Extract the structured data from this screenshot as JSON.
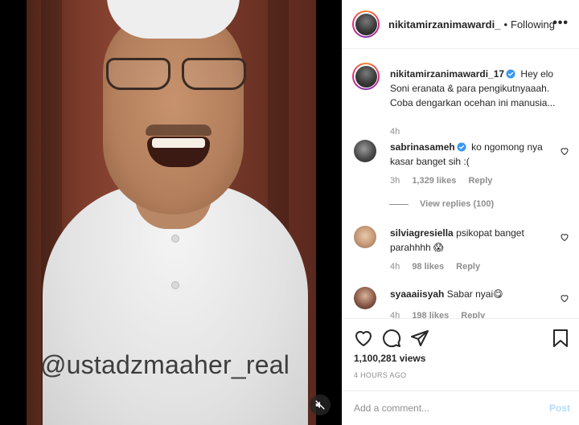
{
  "video": {
    "watermark": "@ustadzmaaher_real",
    "mute_icon": "speaker-muted-icon"
  },
  "header": {
    "username": "nikitamirzanimawardi_",
    "separator": "•",
    "follow_status": "Following",
    "more_label": "•••"
  },
  "caption": {
    "username": "nikitamirzanimawardi_17",
    "text": "Hey elo Soni eranata & para pengikutnyaaah. Coba dengarkan ocehan ini manusia...",
    "time": "4h"
  },
  "comments": [
    {
      "username": "sabrinasameh",
      "verified": true,
      "text": "ko ngomong nya kasar banget sih :(",
      "time": "3h",
      "likes": "1,329 likes",
      "reply": "Reply"
    },
    {
      "username": "silviagresiella",
      "verified": false,
      "text": "psikopat banget parahhhh 😱",
      "time": "4h",
      "likes": "98 likes",
      "reply": "Reply"
    },
    {
      "username": "syaaaiisyah",
      "verified": false,
      "text": "Sabar nyai😋",
      "time": "4h",
      "likes": "198 likes",
      "reply": "Reply"
    }
  ],
  "view_replies": "View replies (100)",
  "actions": {
    "views": "1,100,281 views",
    "timestamp": "4 HOURS AGO"
  },
  "add_comment": {
    "placeholder": "Add a comment...",
    "post_label": "Post"
  },
  "colors": {
    "post_disabled": "#b3dbff",
    "secondary_text": "#8e8e8e",
    "verified_blue": "#3897f0"
  }
}
